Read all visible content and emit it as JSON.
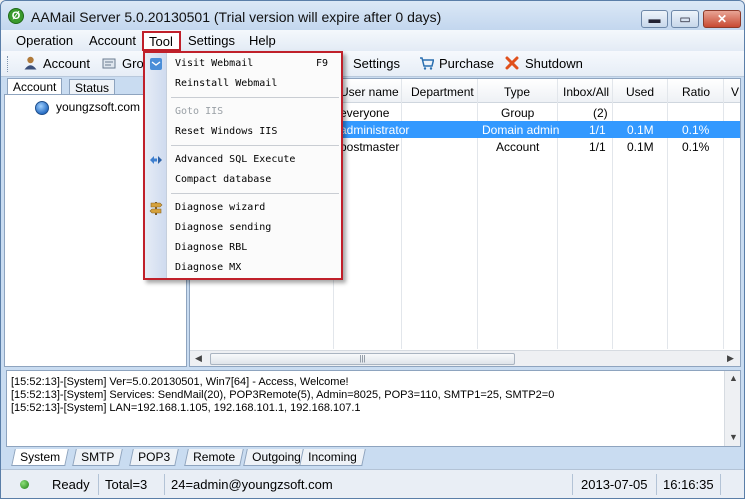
{
  "window": {
    "title": "AAMail Server 5.0.20130501 (Trial version will expire after 0 days)",
    "app_icon": "aamail-logo-icon",
    "controls": {
      "minimize": "▬",
      "maximize": "▭",
      "close": "✕"
    }
  },
  "menubar": {
    "items": [
      "Operation",
      "Account",
      "Tool",
      "Settings",
      "Help"
    ],
    "active": "Tool",
    "highlight_color": "#c0202a"
  },
  "toolbar": {
    "account_label": "Account",
    "groups_label_partial": "Gro",
    "settings_label": "Settings",
    "purchase_label": "Purchase",
    "shutdown_label": "Shutdown"
  },
  "left_panel": {
    "tabs": [
      "Account",
      "Status"
    ],
    "active_tab": "Account",
    "tree_root": "youngzsoft.com"
  },
  "grid": {
    "columns": [
      "User name",
      "Department",
      "Type",
      "Inbox/All",
      "Used",
      "Ratio",
      "V"
    ],
    "rows": [
      {
        "user": "everyone",
        "department": "",
        "type": "Group",
        "inbox_all": "(2)",
        "used": "",
        "ratio": "",
        "selected": false
      },
      {
        "user": "administrator",
        "department": "",
        "type": "Domain admin",
        "inbox_all": "1/1",
        "used": "0.1M",
        "ratio": "0.1%",
        "selected": true
      },
      {
        "user": "postmaster",
        "department": "",
        "type": "Account",
        "inbox_all": "1/1",
        "used": "0.1M",
        "ratio": "0.1%",
        "selected": false
      }
    ],
    "selection_color": "#3399ff"
  },
  "log": {
    "lines": [
      "[15:52:13]-[System] Ver=5.0.20130501, Win7[64] - Access, Welcome!",
      "[15:52:13]-[System] Services: SendMail(20), POP3Remote(5), Admin=8025, POP3=110, SMTP1=25, SMTP2=0",
      "[15:52:13]-[System] LAN=192.168.1.105, 192.168.101.1, 192.168.107.1"
    ]
  },
  "bottom_tabs": {
    "items": [
      "System",
      "SMTP",
      "POP3",
      "Remote",
      "Outgoing",
      "Incoming"
    ],
    "active": "System"
  },
  "statusbar": {
    "state": "Ready",
    "total": "Total=3",
    "message": "24=admin@youngzsoft.com",
    "date": "2013-07-05",
    "time": "16:16:35"
  },
  "tool_menu": {
    "items": [
      {
        "label": "Visit Webmail",
        "shortcut": "F9",
        "icon": "webmail-icon",
        "enabled": true
      },
      {
        "label": "Reinstall Webmail",
        "shortcut": "",
        "icon": "",
        "enabled": true
      },
      {
        "label": "Goto IIS",
        "shortcut": "",
        "icon": "",
        "enabled": false
      },
      {
        "label": "Reset Windows IIS",
        "shortcut": "",
        "icon": "",
        "enabled": true
      },
      {
        "label": "Advanced SQL Execute",
        "shortcut": "",
        "icon": "sql-execute-icon",
        "enabled": true
      },
      {
        "label": "Compact database",
        "shortcut": "",
        "icon": "",
        "enabled": true
      },
      {
        "label": "Diagnose wizard",
        "shortcut": "",
        "icon": "signpost-icon",
        "enabled": true
      },
      {
        "label": "Diagnose sending",
        "shortcut": "",
        "icon": "",
        "enabled": true
      },
      {
        "label": "Diagnose RBL",
        "shortcut": "",
        "icon": "",
        "enabled": true
      },
      {
        "label": "Diagnose MX",
        "shortcut": "",
        "icon": "",
        "enabled": true
      }
    ]
  }
}
